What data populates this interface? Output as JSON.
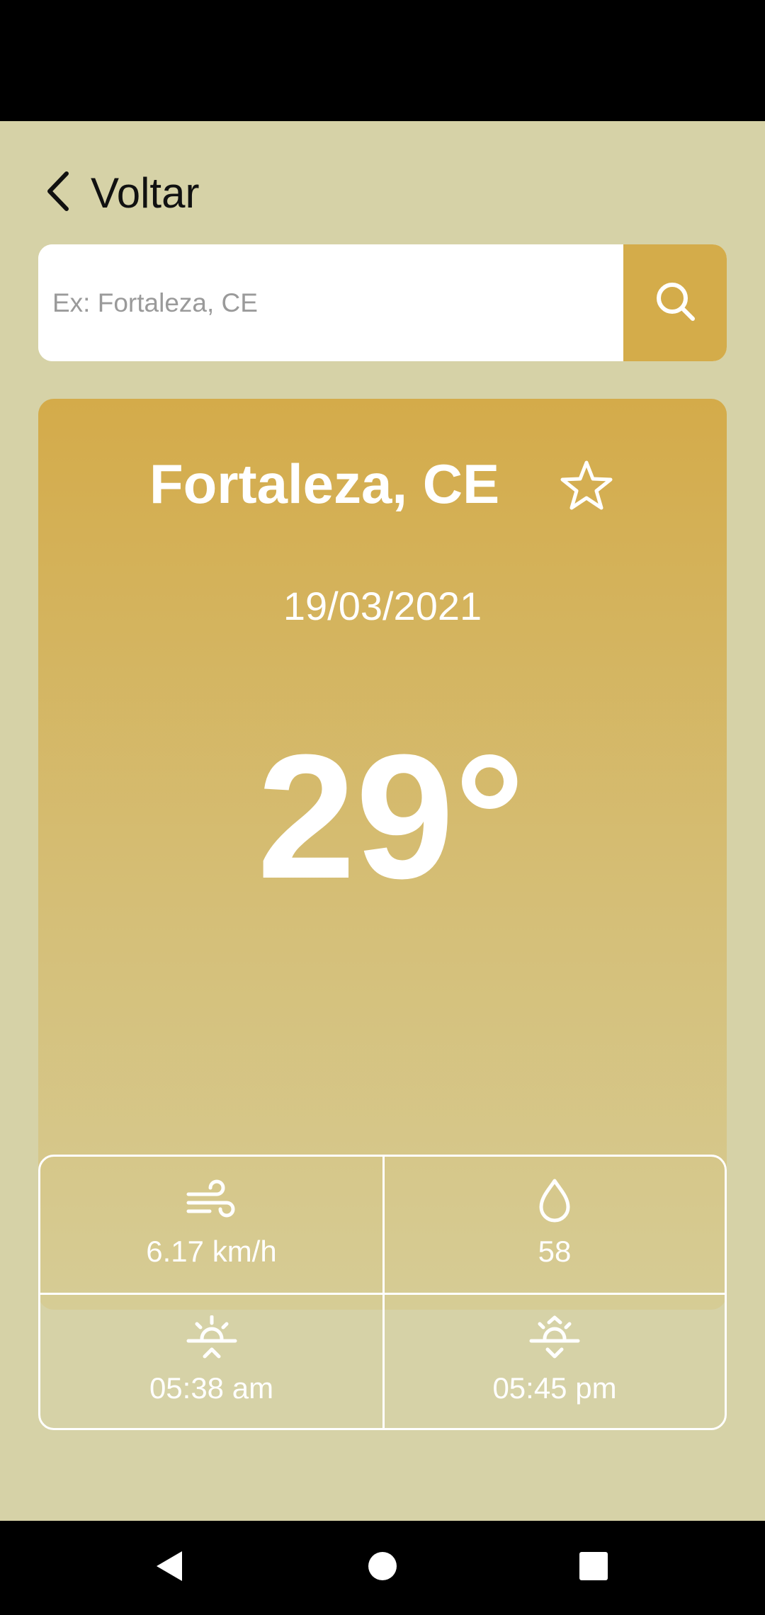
{
  "header": {
    "back_label": "Voltar"
  },
  "search": {
    "placeholder": "Ex: Fortaleza, CE",
    "value": ""
  },
  "weather": {
    "city": "Fortaleza, CE",
    "date": "19/03/2021",
    "temperature": "29°",
    "wind": "6.17 km/h",
    "humidity": "58",
    "sunrise": "05:38 am",
    "sunset": "05:45 pm"
  },
  "icons": {
    "back": "chevron-left-icon",
    "search": "search-icon",
    "favorite": "star-outline-icon",
    "wind": "wind-icon",
    "humidity": "water-drop-icon",
    "sunrise": "sunrise-icon",
    "sunset": "sunset-icon"
  },
  "colors": {
    "background": "#d6d2a7",
    "accent": "#d4ac4a",
    "card_top": "#d4ab4a",
    "card_bottom": "#d6cc95",
    "text_on_card": "#ffffff"
  }
}
